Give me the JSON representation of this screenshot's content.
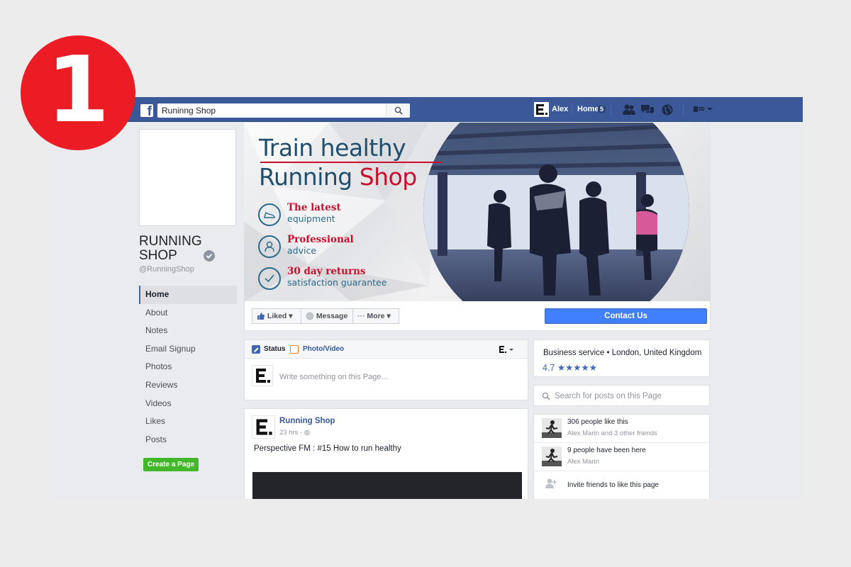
{
  "badge": {
    "number": "1"
  },
  "topbar": {
    "search_value": "Runinng Shop",
    "user_name": "Alex",
    "home_label": "Home",
    "home_count": "5"
  },
  "page": {
    "name": "RUNNING SHOP",
    "handle": "@RunningShop"
  },
  "sidebar": {
    "items": [
      {
        "label": "Home",
        "active": true
      },
      {
        "label": "About"
      },
      {
        "label": "Notes"
      },
      {
        "label": "Email Signup"
      },
      {
        "label": "Photos"
      },
      {
        "label": "Reviews"
      },
      {
        "label": "Videos"
      },
      {
        "label": "Likes"
      },
      {
        "label": "Posts"
      }
    ],
    "create_page": "Create a Page"
  },
  "cover": {
    "title_line1": "Train healthy",
    "title_line2_a": "Running",
    "title_line2_b": "Shop",
    "features": [
      {
        "title": "The latest",
        "sub": "equipment",
        "icon": "shoe-icon"
      },
      {
        "title": "Professional",
        "sub": "advice",
        "icon": "person-icon"
      },
      {
        "title": "30 day returns",
        "sub": "satisfaction guarantee",
        "icon": "check-icon"
      }
    ]
  },
  "actions": {
    "liked": "Liked",
    "message": "Message",
    "more": "More",
    "contact": "Contact Us"
  },
  "composer": {
    "status_tab": "Status",
    "photo_tab": "Photo/Video",
    "placeholder": "Write something on this Page..."
  },
  "post": {
    "author": "Running Shop",
    "time": "23 hrs ·",
    "text": "Perspective FM : #15 How to run healthy"
  },
  "about_card": {
    "category": "Business service • London, United Kingdom",
    "rating": "4.7",
    "stars": 4.7
  },
  "page_search": {
    "placeholder": "Search for posts on this Page"
  },
  "likes_card": {
    "rows": [
      {
        "main": "306 people like this",
        "sub": "Alex Marin and 3 other friends"
      },
      {
        "main": "9 people have been here",
        "sub": "Alex Marin"
      }
    ],
    "invite": "Invite friends to like this page"
  },
  "colors": {
    "facebook_blue": "#3b5998",
    "badge_red": "#ec1c24",
    "contact_blue": "#4080ff",
    "brand_red": "#c8102e",
    "brand_teal": "#1f4e6e",
    "create_green": "#42b72a"
  }
}
